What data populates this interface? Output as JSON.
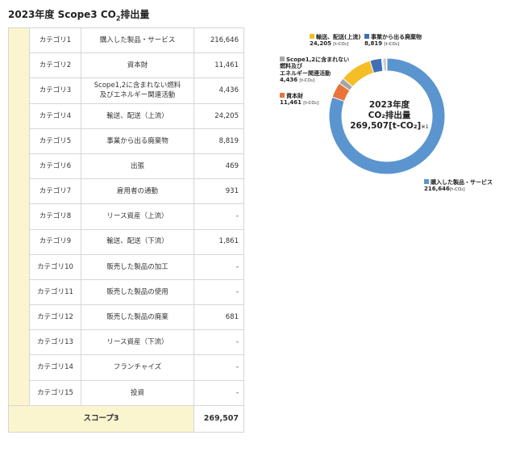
{
  "title": {
    "prefix": "2023年度 Scope3 CO",
    "sub": "2",
    "suffix": "排出量"
  },
  "table": {
    "rows": [
      {
        "category": "カテゴリ1",
        "name": "購入した製品・サービス",
        "value": "216,646"
      },
      {
        "category": "カテゴリ2",
        "name": "資本財",
        "value": "11,461"
      },
      {
        "category": "カテゴリ3",
        "name": "Scope1,2に含まれない燃料\n及びエネルギー関連活動",
        "value": "4,436"
      },
      {
        "category": "カテゴリ4",
        "name": "輸送、配送（上流）",
        "value": "24,205"
      },
      {
        "category": "カテゴリ5",
        "name": "事業から出る廃棄物",
        "value": "8,819"
      },
      {
        "category": "カテゴリ6",
        "name": "出張",
        "value": "469"
      },
      {
        "category": "カテゴリ7",
        "name": "雇用者の通勤",
        "value": "931"
      },
      {
        "category": "カテゴリ8",
        "name": "リース資産（上流）",
        "value": "-"
      },
      {
        "category": "カテゴリ9",
        "name": "輸送、配送（下流）",
        "value": "1,861"
      },
      {
        "category": "カテゴリ10",
        "name": "販売した製品の加工",
        "value": "-"
      },
      {
        "category": "カテゴリ11",
        "name": "販売した製品の使用",
        "value": "-"
      },
      {
        "category": "カテゴリ12",
        "name": "販売した製品の廃棄",
        "value": "681"
      },
      {
        "category": "カテゴリ13",
        "name": "リース資産（下流）",
        "value": "-"
      },
      {
        "category": "カテゴリ14",
        "name": "フランチャイズ",
        "value": "-"
      },
      {
        "category": "カテゴリ15",
        "name": "投資",
        "value": "-"
      }
    ],
    "total_label": "スコープ3",
    "total_value": "269,507"
  },
  "chart_data": {
    "type": "pie",
    "variant": "donut",
    "center": {
      "line1": "2023年度",
      "line2": "CO₂排出量",
      "line3": "269,507[t-CO₂]",
      "note": "※1"
    },
    "unit_label": "[t-CO₂]",
    "slices": [
      {
        "name": "購入した製品・サービス",
        "value": 216646,
        "value_text": "216,646",
        "color": "#5b95cf",
        "labeled": true
      },
      {
        "name": "資本財",
        "value": 11461,
        "value_text": "11,461",
        "color": "#e8743b",
        "labeled": true
      },
      {
        "name": "Scope1,2に含まれない燃料及びエネルギー関連活動",
        "value": 4436,
        "value_text": "4,436",
        "color": "#a6a6a6",
        "labeled": true
      },
      {
        "name": "輸送、配送(上流)",
        "value": 24205,
        "value_text": "24,205",
        "color": "#f5bd26",
        "labeled": true
      },
      {
        "name": "事業から出る廃棄物",
        "value": 8819,
        "value_text": "8,819",
        "color": "#3f6fb5",
        "labeled": true
      },
      {
        "name": "出張",
        "value": 469,
        "color": "#c9c9c9",
        "labeled": false
      },
      {
        "name": "雇用者の通勤",
        "value": 931,
        "color": "#8faed6",
        "labeled": false
      },
      {
        "name": "輸送、配送（下流）",
        "value": 1861,
        "color": "#b7b7b7",
        "labeled": false
      },
      {
        "name": "販売した製品の廃棄",
        "value": 681,
        "color": "#dfe8f3",
        "labeled": false
      }
    ]
  }
}
